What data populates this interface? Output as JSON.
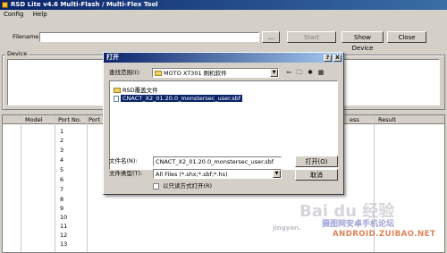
{
  "window": {
    "title": "RSD Lite v4.6 Multi-Flash / Multi-Flex Tool"
  },
  "menu": [
    "Config",
    "Help"
  ],
  "toolbar": {
    "filename_label": "Filename",
    "filename_value": "",
    "browse_label": "...",
    "start_label": "Start",
    "show_device_label": "Show Device",
    "close_label": "Close"
  },
  "device_group": {
    "label": "Device"
  },
  "grid": {
    "columns": [
      "Model",
      "Port No.",
      "Port",
      "ess",
      "Result"
    ],
    "rows": [
      "1",
      "2",
      "3",
      "4",
      "5",
      "6",
      "7",
      "8",
      "9",
      "10",
      "11",
      "12",
      "13"
    ]
  },
  "dialog": {
    "title": "打开",
    "help_button": "?",
    "close_button": "X",
    "look_in_label": "查找范围(I):",
    "look_in_value": "MOTO XT301 刷机软件",
    "items": [
      {
        "type": "folder",
        "name": "RSD覆盖文件"
      },
      {
        "type": "file",
        "name": "CNACT_X2_01.20.0_monstersec_user.sbf",
        "selected": true
      }
    ],
    "filename_label": "文件名(N):",
    "filename_value": "CNACT_X2_01.20.0_monstersec_user.sbf",
    "filetype_label": "文件类型(T):",
    "filetype_value": "All Files (*.shx;*.sbf;*.hs)",
    "open_button": "打开(O)",
    "cancel_button": "取消",
    "readonly_label": "以只读方式打开(R)",
    "readonly_checked": false
  },
  "watermark": {
    "baidu": "Bai du 经验",
    "site_cn": "摄图网安卓手机论坛",
    "site_en": "ANDROID.ZUIBAO.NET",
    "partial": "jingyan."
  }
}
